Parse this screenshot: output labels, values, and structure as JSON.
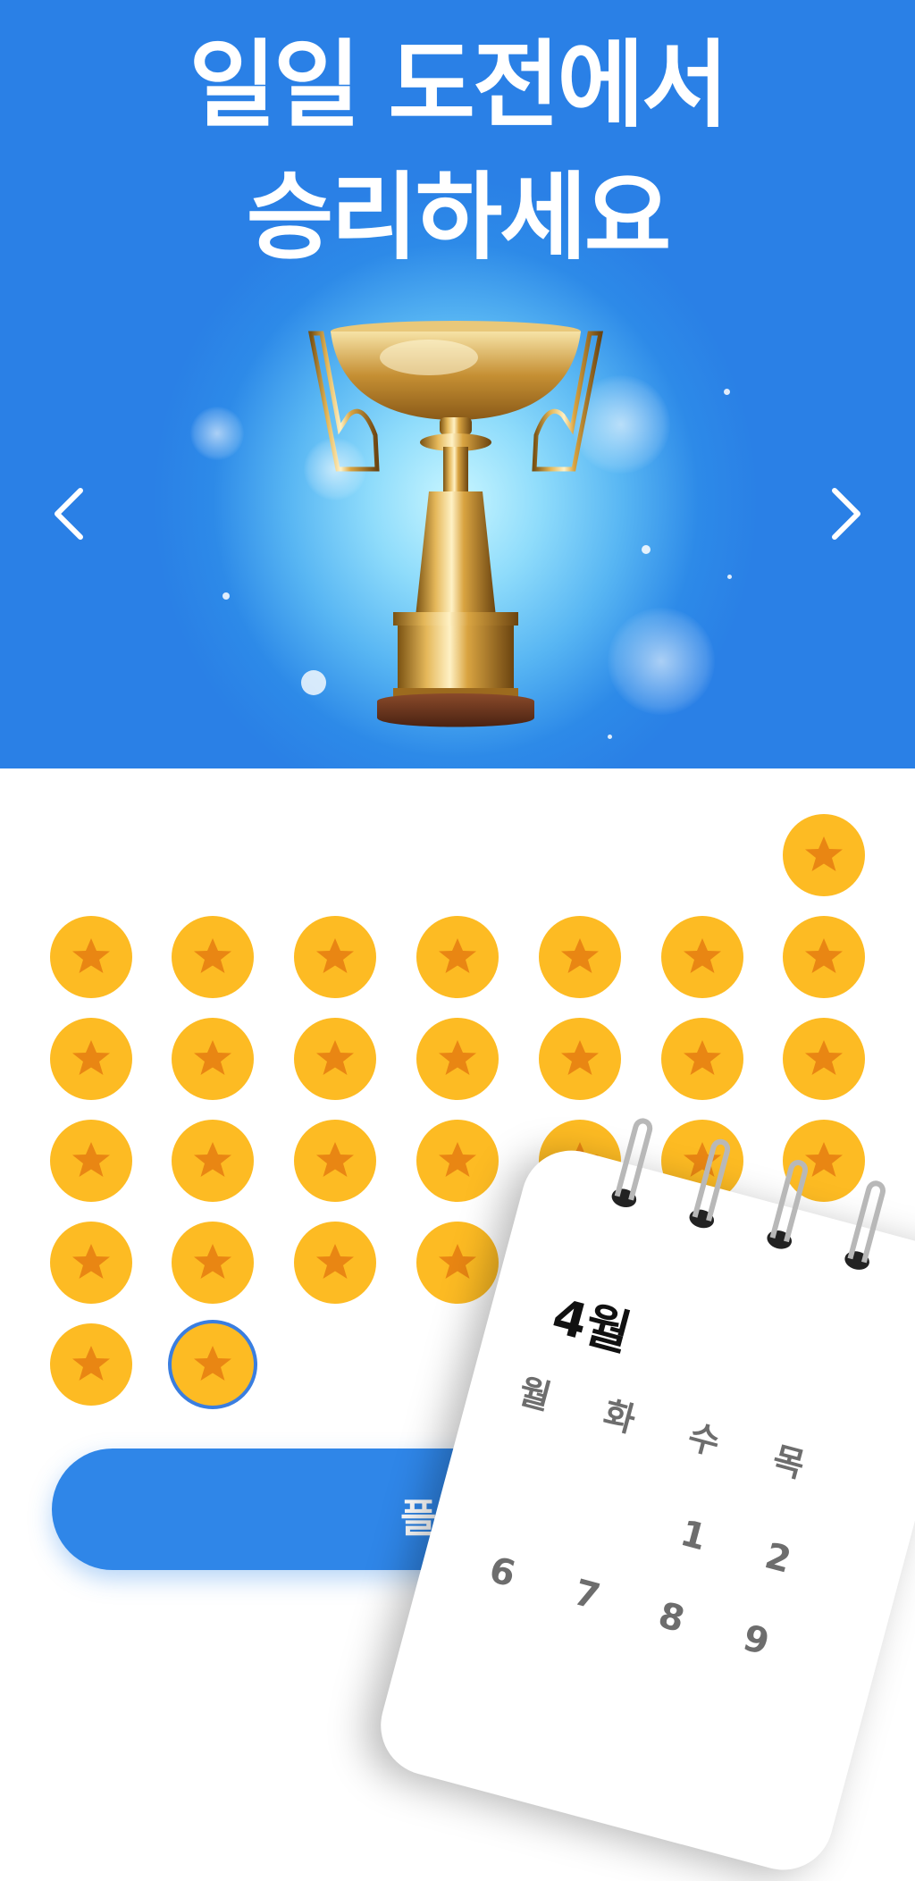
{
  "hero": {
    "title_line1": "일일 도전에서",
    "title_line2": "승리하세요"
  },
  "nav": {
    "prev_icon": "chevron-left-icon",
    "next_icon": "chevron-right-icon"
  },
  "stars": {
    "completed_count": 31,
    "selected_day": 31
  },
  "play_button": {
    "label": "플레이"
  },
  "calendar": {
    "month": "4월",
    "weekdays": [
      "월",
      "화",
      "수",
      "목"
    ],
    "days": [
      "1",
      "2",
      "6",
      "7",
      "8",
      "9"
    ]
  },
  "colors": {
    "hero_blue": "#2a80e6",
    "star_gold": "#fdbb23",
    "star_orange": "#e98613",
    "button_blue": "#2f86e8"
  }
}
